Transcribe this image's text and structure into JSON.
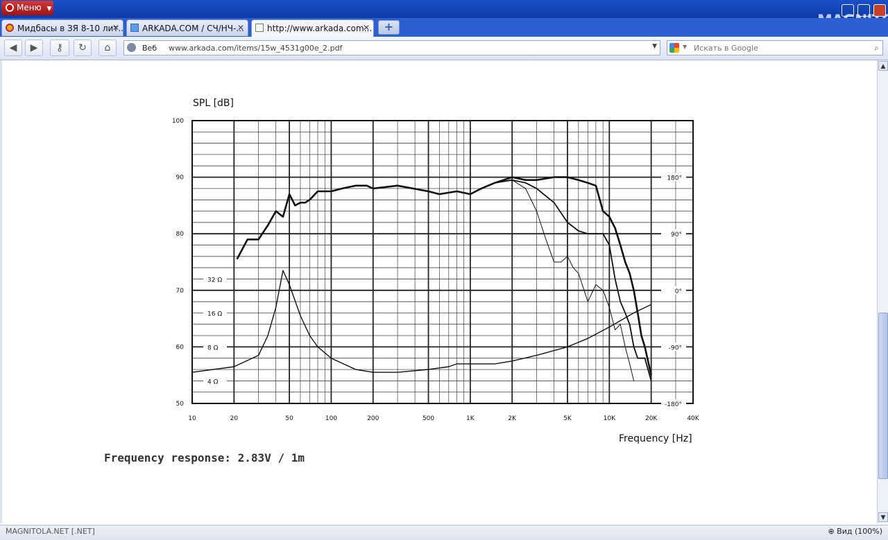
{
  "browser": {
    "menu_label": "Меню",
    "logo_text": "MAGNITOLA",
    "tabs": [
      {
        "title": "Мидбасы в ЗЯ 8-10 лит...",
        "active": false
      },
      {
        "title": "ARKADA.COM / СЧ/НЧ-...",
        "active": false
      },
      {
        "title": "http://www.arkada.com...",
        "active": true
      }
    ],
    "new_tab_symbol": "+",
    "search_engine_label": "Веб",
    "url": "www.arkada.com/items/15w_4531g00e_2.pdf",
    "search_placeholder": "Искать в Google",
    "zoom_label": "Вид (100%)",
    "status_icons_text": "MAGNITOLA.NET [.NET]"
  },
  "document": {
    "caption": "Frequency response: 2.83V / 1m"
  },
  "chart_data": {
    "type": "line",
    "ylabel": "SPL  [dB]",
    "xlabel": "Frequency  [Hz]",
    "x_scale": "log",
    "xlim": [
      10,
      40000
    ],
    "ylim": [
      50,
      100
    ],
    "x_ticks": [
      "10",
      "20",
      "50",
      "100",
      "200",
      "500",
      "1K",
      "2K",
      "5K",
      "10K",
      "20K",
      "40K"
    ],
    "y_ticks": [
      "100",
      "90",
      "80",
      "70",
      "60",
      "50"
    ],
    "impedance_ticks": [
      {
        "label": "32  Ω",
        "db": 72
      },
      {
        "label": "16  Ω",
        "db": 66
      },
      {
        "label": "8  Ω",
        "db": 60
      },
      {
        "label": "4  Ω",
        "db": 54
      }
    ],
    "phase_ticks": [
      {
        "label": "180°",
        "db": 90
      },
      {
        "label": "90°",
        "db": 80
      },
      {
        "label": "0°",
        "db": 70
      },
      {
        "label": "-90°",
        "db": 60
      },
      {
        "label": "-180°",
        "db": 50
      }
    ],
    "grid": true,
    "series": [
      {
        "style": "thick",
        "x": [
          21,
          25,
          30,
          35,
          40,
          45,
          50,
          55,
          60,
          65,
          70,
          80,
          90,
          100,
          120,
          150,
          180,
          200,
          300,
          500,
          600,
          800,
          1000,
          1200,
          1500,
          2000,
          2500,
          3000,
          4000,
          5000,
          6000,
          7000,
          8000,
          9000,
          10000,
          11000,
          12000,
          13000,
          14000,
          15000,
          16000,
          17000,
          18000,
          20000
        ],
        "y": [
          75.5,
          79,
          79,
          81.5,
          84,
          83,
          87,
          85,
          85.5,
          85.5,
          86,
          87.5,
          87.5,
          87.5,
          88,
          88.5,
          88.5,
          88,
          88.5,
          87.5,
          87,
          87.5,
          87,
          88,
          89,
          90,
          89.5,
          89.5,
          90,
          90,
          89.5,
          89,
          88.5,
          84,
          83,
          81,
          78,
          75,
          73,
          70,
          66,
          62,
          60,
          55
        ]
      },
      {
        "style": "medium",
        "x": [
          1500,
          2000,
          2500,
          3000,
          4000,
          5000,
          6000,
          7000,
          8000,
          9000,
          10000,
          11000,
          12000,
          13000,
          14000,
          15000,
          16000,
          18000,
          20000
        ],
        "y": [
          89,
          89.5,
          89,
          88,
          85.5,
          82,
          80.5,
          80,
          80,
          80,
          78,
          72,
          68,
          66,
          64,
          60,
          58,
          58,
          54
        ]
      },
      {
        "style": "thin",
        "x": [
          1500,
          2000,
          2500,
          3000,
          3500,
          4000,
          4500,
          5000,
          5500,
          6000,
          7000,
          8000,
          9000,
          10000,
          11000,
          12000,
          13000,
          14000,
          15000
        ],
        "y": [
          89,
          89.5,
          88,
          84,
          79,
          75,
          75,
          76,
          74,
          73,
          68,
          71,
          70,
          67,
          63,
          64,
          60,
          57,
          54
        ]
      },
      {
        "style": "impedance",
        "x": [
          10,
          20,
          30,
          35,
          40,
          45,
          50,
          60,
          70,
          80,
          100,
          150,
          200,
          300,
          500,
          700,
          800,
          1000,
          1500,
          2000,
          3000,
          5000,
          7000,
          10000,
          15000,
          20000
        ],
        "y": [
          55.5,
          56.5,
          58.5,
          62,
          67,
          73.5,
          71,
          65.5,
          62,
          60,
          58,
          56,
          55.5,
          55.5,
          56,
          56.5,
          57,
          57,
          57,
          57.5,
          58.5,
          60,
          61.5,
          63.5,
          66,
          67.5
        ]
      }
    ]
  }
}
